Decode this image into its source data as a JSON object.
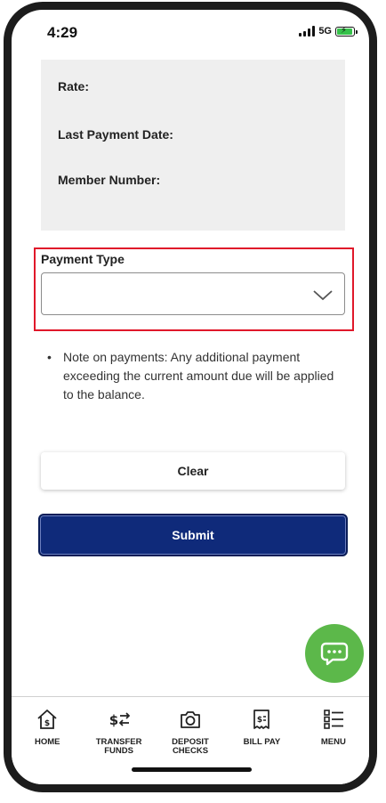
{
  "status_bar": {
    "time": "4:29",
    "network": "5G"
  },
  "info_box": {
    "rate_label": "Rate:",
    "last_payment_label": "Last Payment Date:",
    "member_number_label": "Member Number:"
  },
  "payment_type": {
    "label": "Payment Type",
    "selected_value": ""
  },
  "note": {
    "text": "Note on payments: Any additional payment exceeding the current amount due will be applied to the balance."
  },
  "buttons": {
    "clear_label": "Clear",
    "submit_label": "Submit"
  },
  "bottom_nav": {
    "items": [
      {
        "label": "HOME",
        "icon": "home-icon"
      },
      {
        "label": "TRANSFER\nFUNDS",
        "icon": "transfer-icon"
      },
      {
        "label": "DEPOSIT\nCHECKS",
        "icon": "camera-icon"
      },
      {
        "label": "BILL PAY",
        "icon": "bill-icon"
      },
      {
        "label": "MENU",
        "icon": "menu-list-icon"
      }
    ]
  },
  "colors": {
    "submit_bg": "#0f2a7a",
    "chat_fab": "#5cb84a",
    "highlight": "#e0182a",
    "battery": "#36c14a"
  }
}
